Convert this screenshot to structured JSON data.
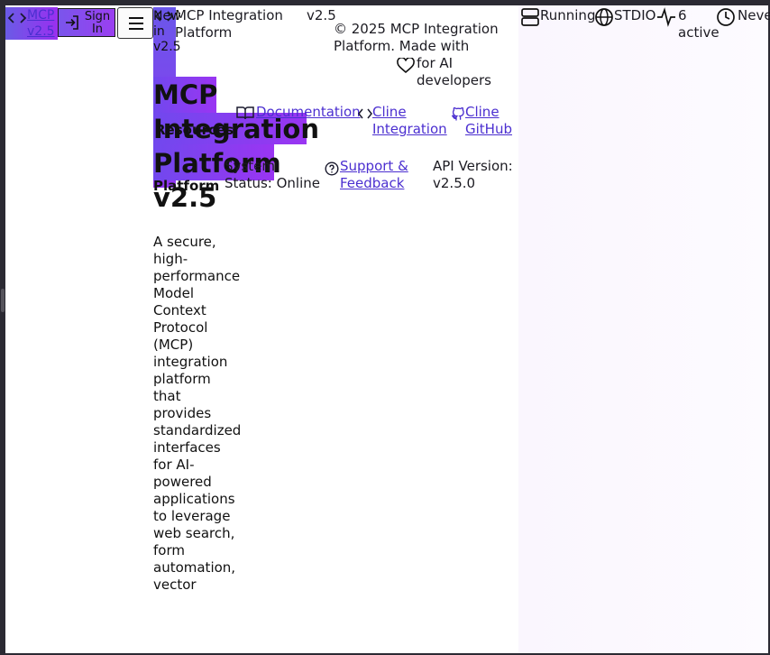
{
  "header": {
    "logo_link": "MCP v2.5",
    "sign_in": "Sign In",
    "new_in": "New in v2.5",
    "brand": "MCP Integration Platform",
    "version": "v2.5"
  },
  "footer": {
    "copyright": "© 2025 MCP Integration Platform. Made with",
    "for_ai": "for AI developers",
    "resources_heading": "Resources",
    "platform_heading": "Platform",
    "links": {
      "documentation": "Documentation",
      "cline_integration": "Cline Integration",
      "cline_github": "Cline GitHub",
      "support": "Support & Feedback"
    },
    "system_status": "System Status: Online",
    "api_version": "API Version: v2.5.0"
  },
  "hero": {
    "title": "MCP Integration Platform v2.5",
    "description": "A secure, high-performance Model Context Protocol (MCP) integration platform that provides standardized interfaces for AI-powered applications to leverage web search, form automation, vector"
  },
  "status_bar": {
    "server": "Running",
    "transport": "STDIO",
    "connections": "6 active",
    "last": "Neve"
  },
  "colors": {
    "accent_gradient_start": "#6a57ea",
    "accent_gradient_end": "#9a35f2",
    "link": "#4b2fd0"
  }
}
